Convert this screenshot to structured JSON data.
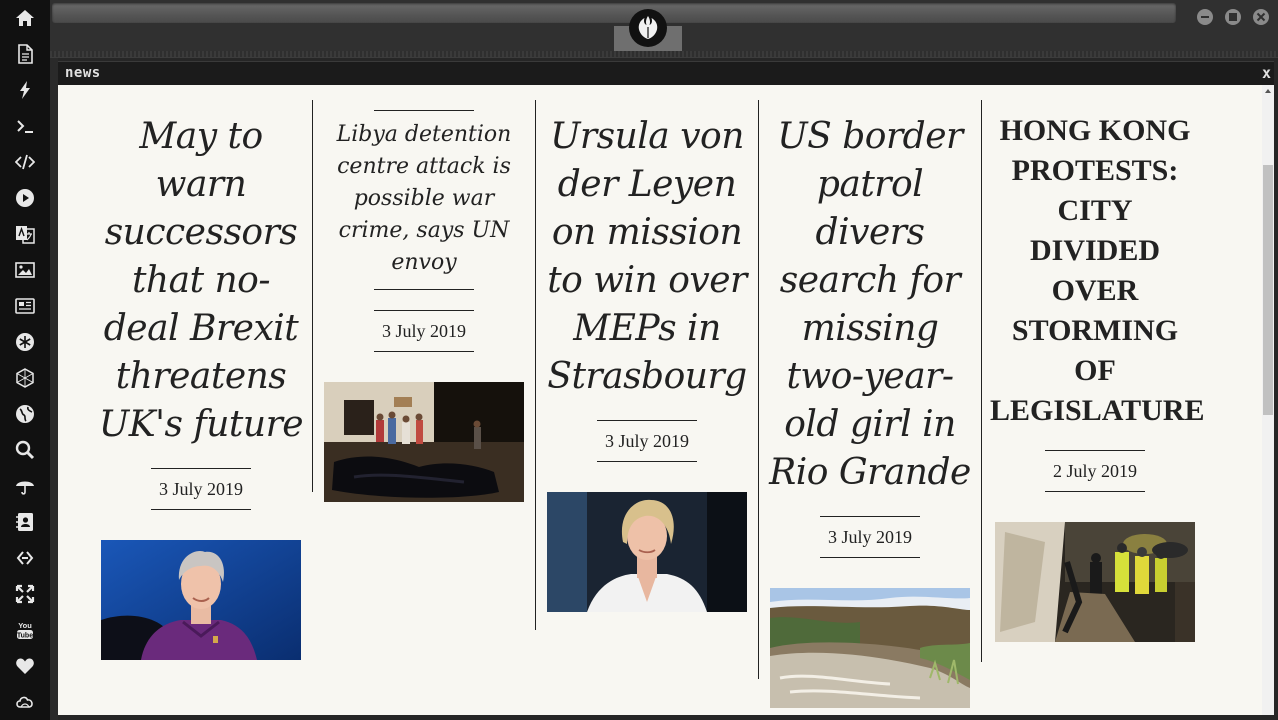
{
  "window": {
    "title": "news",
    "close_label": "x"
  },
  "sidebar": {
    "icons": [
      "home-icon",
      "document-icon",
      "lightning-icon",
      "terminal-icon",
      "code-icon",
      "play-icon",
      "translate-icon",
      "image-icon",
      "newspaper-icon",
      "asterisk-icon",
      "cube-icon",
      "globe-icon",
      "search-icon",
      "umbrella-icon",
      "contacts-icon",
      "link-icon",
      "expand-icon",
      "youtube-icon",
      "heart-icon",
      "cloud-icon"
    ],
    "youtube_label": "You Tube"
  },
  "articles": [
    {
      "headline": "May to warn successors that no-deal Brexit threatens UK's future",
      "date": "3 July 2019",
      "image": "theresa-may-photo"
    },
    {
      "headline": "Libya detention centre attack is possible war crime, says UN envoy",
      "date": "3 July 2019",
      "image": "libya-detention-centre-photo"
    },
    {
      "headline": "Ursula von der Leyen on mission to win over MEPs in Strasbourg",
      "date": "3 July 2019",
      "image": "ursula-von-der-leyen-photo"
    },
    {
      "headline": "US border patrol divers search for missing two-year-old girl in Rio Grande",
      "date": "3 July 2019",
      "image": "rio-grande-photo"
    },
    {
      "headline": "HONG KONG PROTESTS: CITY DIVIDED OVER STORMING OF LEGISLATURE",
      "date": "2 July 2019",
      "image": "hong-kong-protest-photo"
    }
  ],
  "colors": {
    "content_bg": "#f8f7f2",
    "sidebar_bg": "#111111",
    "text": "#222222"
  }
}
